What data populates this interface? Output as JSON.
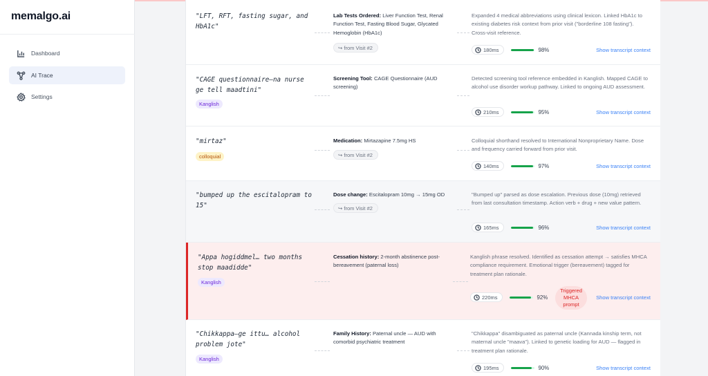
{
  "app": {
    "logo": "memalgo.ai"
  },
  "sidebar": {
    "items": [
      {
        "label": "Dashboard",
        "icon": "bar-chart-icon",
        "active": false
      },
      {
        "label": "AI Trace",
        "icon": "network-icon",
        "active": true
      },
      {
        "label": "Settings",
        "icon": "gear-icon",
        "active": false
      }
    ]
  },
  "rows": [
    {
      "quote": "\"LFT, RFT, fasting sugar, and HbA1c\"",
      "tag": "",
      "output_label": "Lab Tests Ordered:",
      "output_text": "Liver Function Test, Renal Function Test, Fasting Blood Sugar, Glycated Hemoglobin (HbA1c)",
      "chip": "from Visit #2",
      "reason": "Expanded 4 medical abbreviations using clinical lexicon. Linked HbA1c to existing diabetes risk context from prior visit (\"borderline 108 fasting\"). Cross-visit reference.",
      "latency": "180ms",
      "confidence": 98,
      "confidence_label": "98%",
      "link": "Show transcript context"
    },
    {
      "quote": "\"CAGE questionnaire—na nurse ge tell maadtini\"",
      "tag": "Kanglish",
      "output_label": "Screening Tool:",
      "output_text": "CAGE Questionnaire (AUD screening)",
      "chip": "",
      "reason": "Detected screening tool reference embedded in Kanglish. Mapped CAGE to alcohol use disorder workup pathway. Linked to ongoing AUD assessment.",
      "latency": "210ms",
      "confidence": 95,
      "confidence_label": "95%",
      "link": "Show transcript context"
    },
    {
      "quote": "\"mirtaz\"",
      "tag": "colloquial",
      "output_label": "Medication:",
      "output_text": "Mirtazapine 7.5mg HS",
      "chip": "from Visit #2",
      "reason": "Colloquial shorthand resolved to International Nonproprietary Name. Dose and frequency carried forward from prior visit.",
      "latency": "140ms",
      "confidence": 97,
      "confidence_label": "97%",
      "link": "Show transcript context"
    },
    {
      "quote": "\"bumped up the escitalopram to 15\"",
      "tag": "",
      "output_label": "Dose change:",
      "output_text": "Escitalopram 10mg → 15mg OD",
      "chip": "from Visit #2",
      "reason": "\"Bumped up\" parsed as dose escalation. Previous dose (10mg) retrieved from last consultation timestamp. Action verb + drug + new value pattern.",
      "latency": "165ms",
      "confidence": 96,
      "confidence_label": "96%",
      "link": "Show transcript context"
    },
    {
      "quote": "\"Appa hogiddmel… two months stop maadidde\"",
      "tag": "Kanglish",
      "output_label": "Cessation history:",
      "output_text": "2-month abstinence post-bereavement (paternal loss)",
      "chip": "",
      "reason": "Kanglish phrase resolved. Identified as cessation attempt → satisfies MHCA compliance requirement. Emotional trigger (bereavement) tagged for treatment plan rationale.",
      "latency": "220ms",
      "confidence": 92,
      "confidence_label": "92%",
      "trigger": "Triggered MHCA prompt",
      "link": "Show transcript context"
    },
    {
      "quote": "\"Chikkappa—ge ittu… alcohol problem jote\"",
      "tag": "Kanglish",
      "output_label": "Family History:",
      "output_text": "Paternal uncle — AUD with comorbid psychiatric treatment",
      "chip": "",
      "reason": "\"Chikkappa\" disambiguated as paternal uncle (Kannada kinship term, not maternal uncle \"maava\"). Linked to genetic loading for AUD — flagged in treatment plan rationale.",
      "latency": "195ms",
      "confidence": 90,
      "confidence_label": "90%",
      "link": "Show transcript context"
    }
  ],
  "colors": {
    "accent": "#3b82f6",
    "alert": "#dc2626",
    "success": "#16a34a",
    "kanglish": "#6d28d9",
    "colloquial": "#b45309"
  }
}
